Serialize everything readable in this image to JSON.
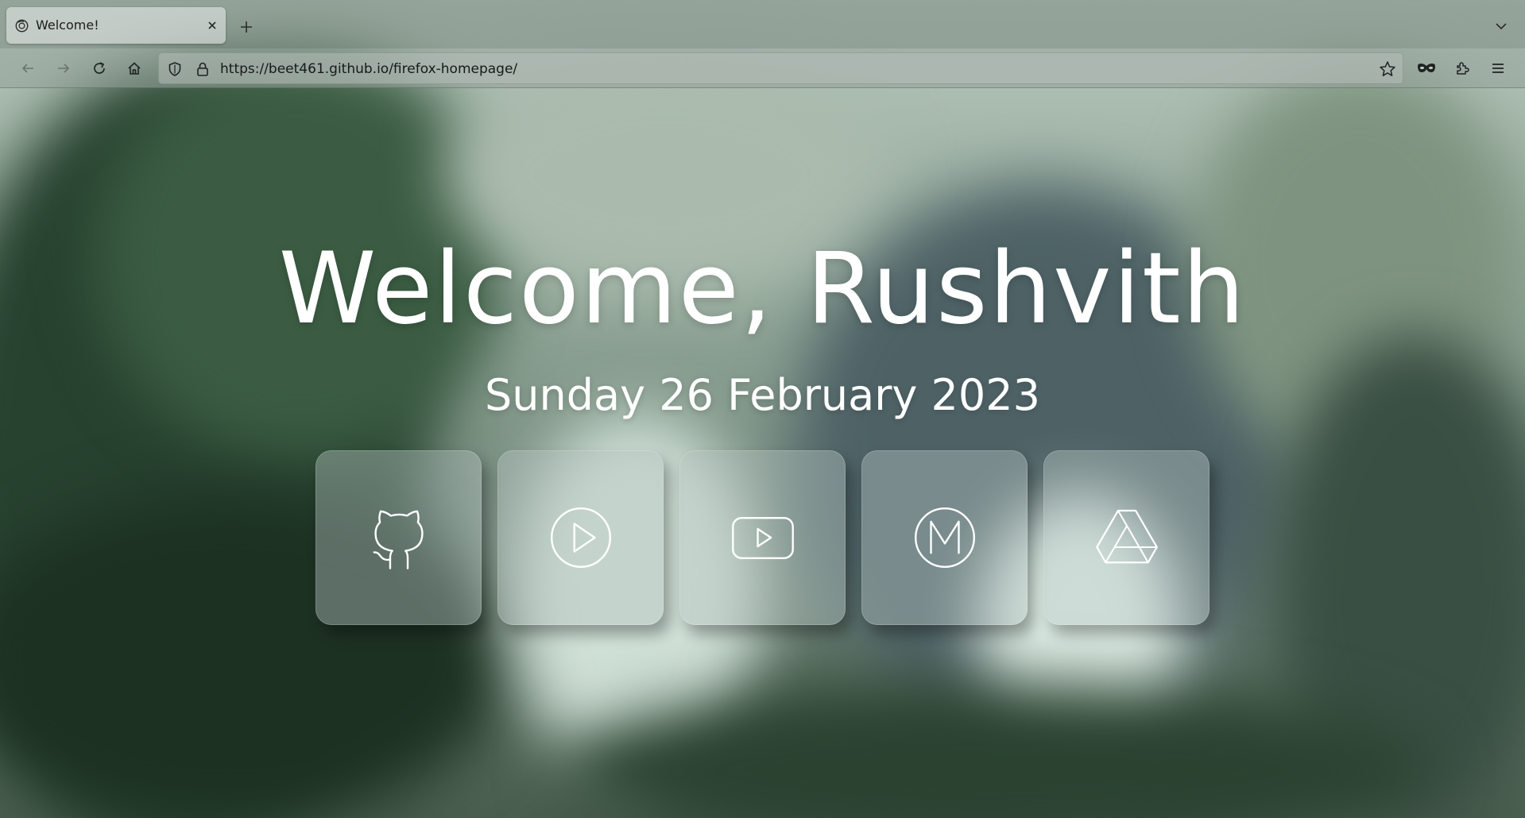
{
  "browser": {
    "tab": {
      "title": "Welcome!",
      "favicon": "firefox-homepage-favicon"
    },
    "url": "https://beet461.github.io/firefox-homepage/",
    "icons": {
      "back": "arrow-left-icon",
      "forward": "arrow-right-icon",
      "reload": "reload-icon",
      "home": "home-icon",
      "tracking_protection": "shield-icon",
      "secure": "lock-icon",
      "bookmark": "star-icon",
      "private": "mask-icon",
      "extensions": "puzzle-icon",
      "menu": "hamburger-menu-icon",
      "new_tab": "plus-icon",
      "list_tabs": "chevron-down-icon",
      "close_tab": "close-icon"
    }
  },
  "page": {
    "greeting": "Welcome, Rushvith",
    "date": "Sunday 26 February 2023",
    "shortcuts": [
      {
        "name": "GitHub",
        "icon": "github-icon"
      },
      {
        "name": "Play",
        "icon": "play-circle-icon"
      },
      {
        "name": "YouTube",
        "icon": "youtube-icon"
      },
      {
        "name": "Gmail",
        "icon": "gmail-m-icon"
      },
      {
        "name": "Google Drive",
        "icon": "google-drive-icon"
      }
    ]
  },
  "colors": {
    "text": "#ffffff",
    "chrome_text": "#1c1c1e"
  }
}
